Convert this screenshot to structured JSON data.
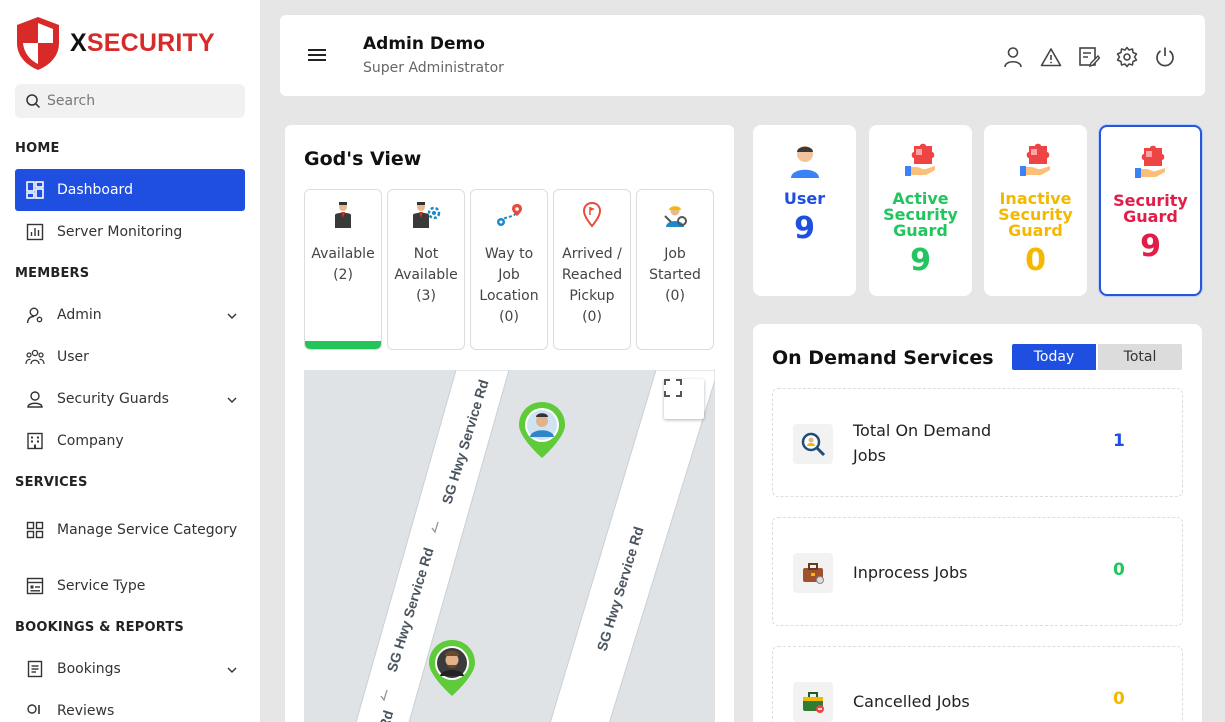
{
  "brand": {
    "prefix": "X",
    "name": "SECURITY"
  },
  "search": {
    "placeholder": "Search"
  },
  "sidebar": {
    "sections": {
      "home": "HOME",
      "members": "MEMBERS",
      "services": "SERVICES",
      "bookings": "BOOKINGS & REPORTS"
    },
    "items": {
      "dashboard": "Dashboard",
      "server_monitoring": "Server Monitoring",
      "admin": "Admin",
      "user": "User",
      "security_guards": "Security Guards",
      "company": "Company",
      "manage_service_category": "Manage Service Category",
      "service_type": "Service Type",
      "bookings": "Bookings",
      "reviews": "Reviews"
    }
  },
  "header": {
    "name": "Admin Demo",
    "role": "Super Administrator"
  },
  "gods_view": {
    "title": "God's View",
    "statuses": [
      {
        "label": "Available",
        "count": "(2)"
      },
      {
        "label": "Not Available",
        "count": "(3)"
      },
      {
        "label": "Way to Job Location",
        "count": "(0)"
      },
      {
        "label": "Arrived / Reached Pickup",
        "count": "(0)"
      },
      {
        "label": "Job Started",
        "count": "(0)"
      }
    ],
    "road_label": "SG Hwy Service Rd",
    "road_label_short": "Rd"
  },
  "stats": [
    {
      "label": "User",
      "value": "9",
      "color": "#1f4fe0"
    },
    {
      "label": "Active Security Guard",
      "value": "9",
      "color": "#22c55e"
    },
    {
      "label": "Inactive Security Guard",
      "value": "0",
      "color": "#f5b800"
    },
    {
      "label": "Security Guard",
      "value": "9",
      "color": "#e11d48"
    }
  ],
  "on_demand": {
    "title": "On Demand Services",
    "tabs": {
      "today": "Today",
      "total": "Total"
    },
    "rows": [
      {
        "label": "Total On Demand Jobs",
        "value": "1",
        "color": "#1f4fe0"
      },
      {
        "label": "Inprocess Jobs",
        "value": "0",
        "color": "#22c55e"
      },
      {
        "label": "Cancelled Jobs",
        "value": "0",
        "color": "#f5b800"
      }
    ]
  }
}
